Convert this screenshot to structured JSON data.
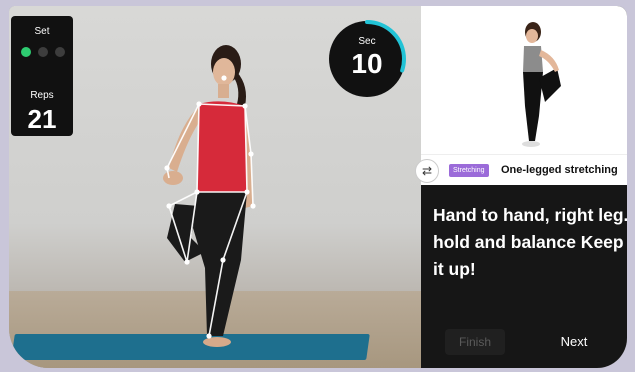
{
  "set": {
    "label": "Set",
    "total": 3,
    "completed": 1
  },
  "reps": {
    "label": "Reps",
    "value": "21"
  },
  "timer": {
    "label": "Sec",
    "value": "10",
    "progress": 0.3,
    "accent": "#22c3d6"
  },
  "exercise": {
    "category": "Stretching",
    "name": "One-legged stretching",
    "instruction": "Hand to hand, right leg. hold and balance Keep it up!"
  },
  "buttons": {
    "finish": "Finish",
    "next": "Next"
  },
  "colors": {
    "set_active": "#2ecc71",
    "badge": "#9b6bd9",
    "mat": "#1e6f8e",
    "shirt": "#d62a3a"
  }
}
